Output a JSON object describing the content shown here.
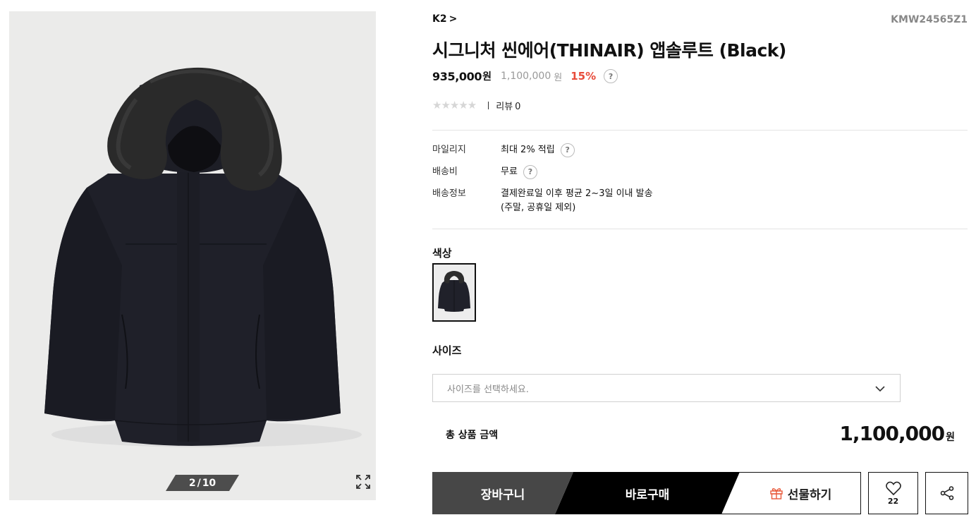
{
  "gallery": {
    "current": "2",
    "separator": "/",
    "total": "10"
  },
  "product": {
    "brand": "K2",
    "brand_chevron": ">",
    "sku": "KMW24565Z1",
    "title": "시그니처 씬에어(THINAIR) 앱솔루트 (Black)",
    "sale_price": "935,000",
    "sale_unit": "원",
    "original_price": "1,100,000",
    "original_unit": "원",
    "discount": "15%",
    "help_glyph": "?"
  },
  "rating": {
    "stars": "★★★★★",
    "review_label": "리뷰",
    "review_count": "0"
  },
  "info": [
    {
      "label": "마일리지",
      "value": "최대 2% 적립"
    },
    {
      "label": "배송비",
      "value": "무료"
    },
    {
      "label": "배송정보",
      "value_line1": "결제완료일 이후 평균 2~3일 이내 발송",
      "value_line2": "(주말, 공휴일 제외)"
    }
  ],
  "color": {
    "label": "색상",
    "selected": "Black"
  },
  "size": {
    "label": "사이즈",
    "placeholder": "사이즈를 선택하세요."
  },
  "total": {
    "label": "총 상품 금액",
    "amount": "1,100,000",
    "unit": "원"
  },
  "actions": {
    "cart": "장바구니",
    "buy": "바로구매",
    "gift": "선물하기",
    "like_count": "22"
  },
  "colors": {
    "discount": "#e84b3a",
    "gift_icon": "#e8593a",
    "cart_bg": "#474747",
    "buy_bg": "#000000"
  },
  "icons": {
    "zoom": "expand-icon",
    "dropdown": "chevron-down-icon",
    "gift": "gift-icon",
    "like": "heart-icon",
    "share": "share-icon"
  }
}
